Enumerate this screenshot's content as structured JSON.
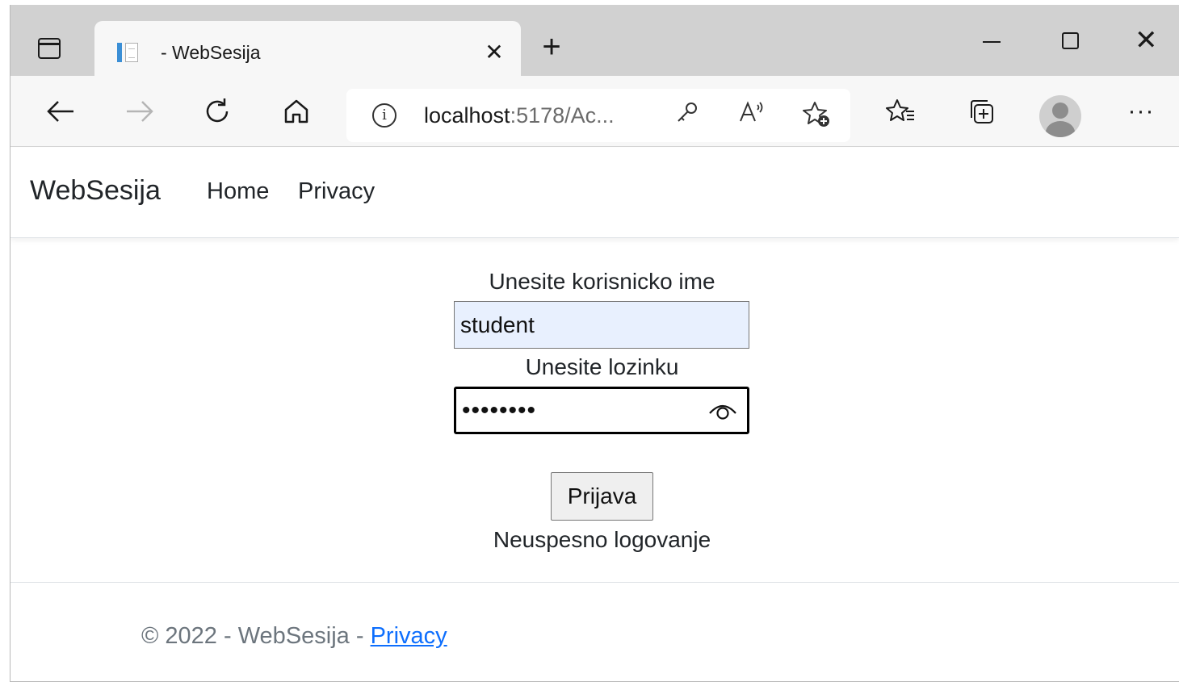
{
  "browser": {
    "tab_title": "- WebSesija",
    "tab_close": "✕",
    "new_tab": "+",
    "url_host": "localhost",
    "url_rest": ":5178/Ac...",
    "info_glyph": "i",
    "more_glyph": "···",
    "window_close": "✕"
  },
  "navbar": {
    "brand": "WebSesija",
    "links": [
      "Home",
      "Privacy"
    ]
  },
  "form": {
    "username_label": "Unesite korisnicko ime",
    "username_value": "student",
    "password_label": "Unesite lozinku",
    "password_value": "••••••••",
    "submit_label": "Prijava",
    "status_message": "Neuspesno logovanje"
  },
  "footer": {
    "text": "© 2022 - WebSesija - ",
    "link": "Privacy"
  },
  "colors": {
    "link": "#0d6efd",
    "autofill_bg": "#e8f0fe",
    "muted": "#6c757d"
  }
}
